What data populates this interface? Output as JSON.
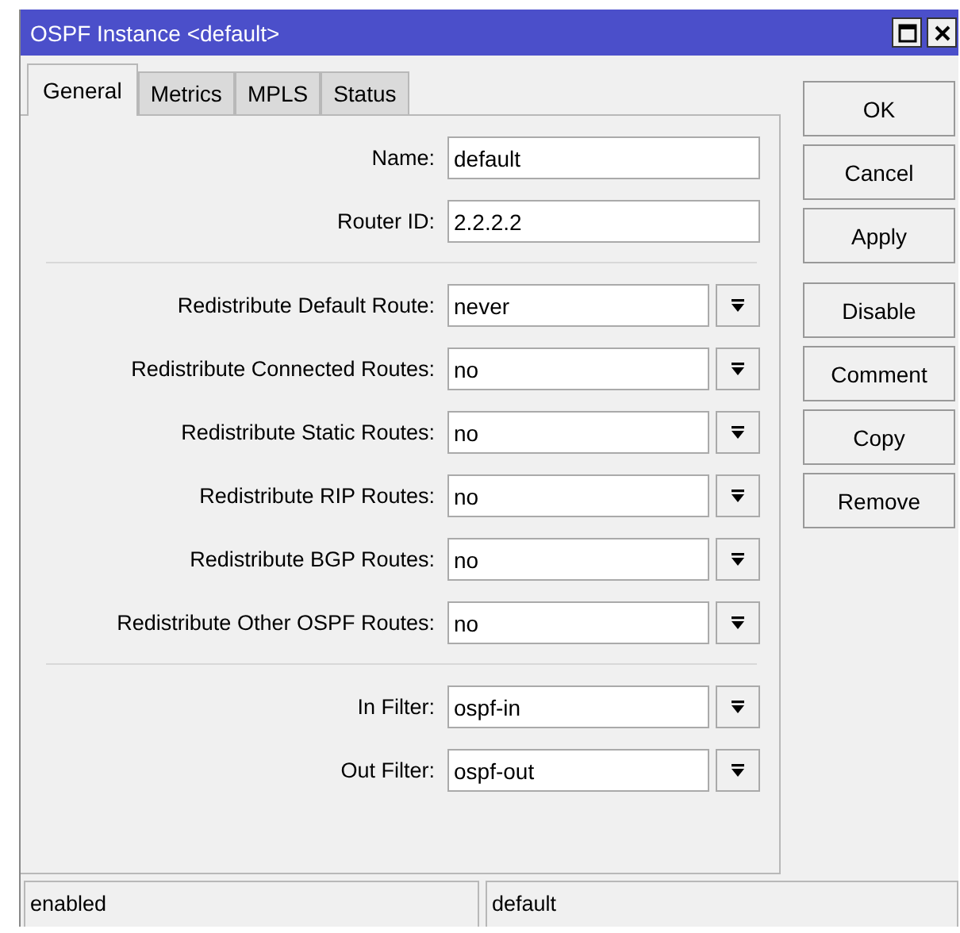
{
  "window": {
    "title": "OSPF Instance <default>"
  },
  "tabs": [
    {
      "label": "General",
      "selected": true
    },
    {
      "label": "Metrics",
      "selected": false
    },
    {
      "label": "MPLS",
      "selected": false
    },
    {
      "label": "Status",
      "selected": false
    }
  ],
  "sections": [
    [
      {
        "label": "Name:",
        "value": "default",
        "kind": "text"
      },
      {
        "label": "Router ID:",
        "value": "2.2.2.2",
        "kind": "text"
      }
    ],
    [
      {
        "label": "Redistribute Default Route:",
        "value": "never",
        "kind": "combo"
      },
      {
        "label": "Redistribute Connected Routes:",
        "value": "no",
        "kind": "combo"
      },
      {
        "label": "Redistribute Static Routes:",
        "value": "no",
        "kind": "combo"
      },
      {
        "label": "Redistribute RIP Routes:",
        "value": "no",
        "kind": "combo"
      },
      {
        "label": "Redistribute BGP Routes:",
        "value": "no",
        "kind": "combo"
      },
      {
        "label": "Redistribute Other OSPF Routes:",
        "value": "no",
        "kind": "combo"
      }
    ],
    [
      {
        "label": "In Filter:",
        "value": "ospf-in",
        "kind": "combo"
      },
      {
        "label": "Out Filter:",
        "value": "ospf-out",
        "kind": "combo"
      }
    ]
  ],
  "button_groups": [
    [
      "OK",
      "Cancel",
      "Apply"
    ],
    [
      "Disable",
      "Comment",
      "Copy",
      "Remove"
    ]
  ],
  "status_bar": [
    "enabled",
    "default"
  ]
}
